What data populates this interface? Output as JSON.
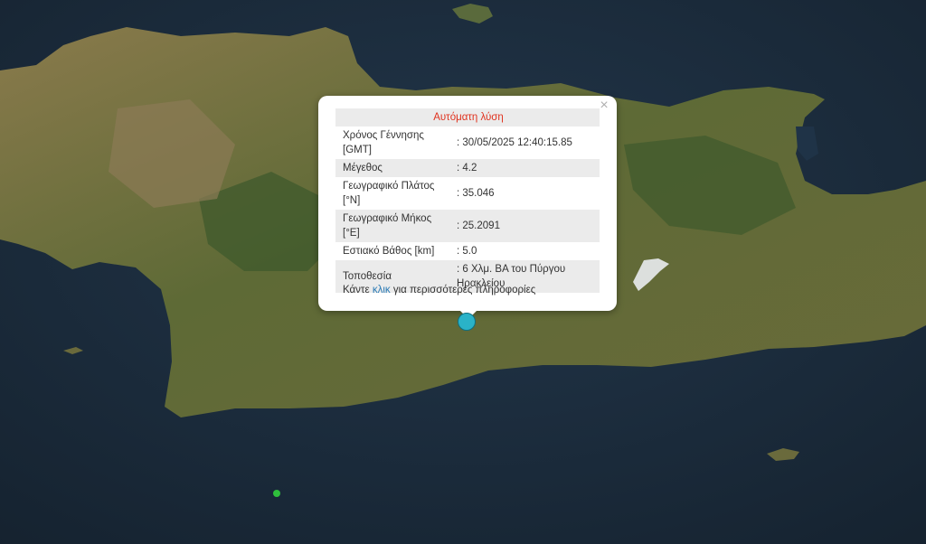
{
  "popup": {
    "header": "Αυτόματη λύση",
    "close_symbol": "×",
    "rows": [
      {
        "label": "Χρόνος Γέννησης [GMT]",
        "value": ": 30/05/2025 12:40:15.85"
      },
      {
        "label": "Μέγεθος",
        "value": ": 4.2"
      },
      {
        "label": "Γεωγραφικό Πλάτος [°N]",
        "value": ": 35.046"
      },
      {
        "label": "Γεωγραφικό Μήκος [°E]",
        "value": ": 25.2091"
      },
      {
        "label": "Εστιακό Βάθος [km]",
        "value": ": 5.0"
      },
      {
        "label": "Τοποθεσία",
        "value": ": 6 Χλμ. ΒΑ του Πύργου Ηρακλείου"
      }
    ],
    "footer_prefix": "Κάντε",
    "footer_link": "κλικ",
    "footer_suffix": "για περισσότερες πληροφορίες"
  },
  "markers": [
    {
      "name": "selected-earthquake",
      "color": "#2ab3c8",
      "icon": "circle-marker-icon"
    },
    {
      "name": "other-earthquake",
      "color": "#2fbf3c",
      "icon": "dot-marker-icon"
    }
  ],
  "colors": {
    "sea": "#1b2c3f",
    "land": "#6f6a3c",
    "header_text": "#e0321e",
    "link": "#2a7ab5"
  }
}
